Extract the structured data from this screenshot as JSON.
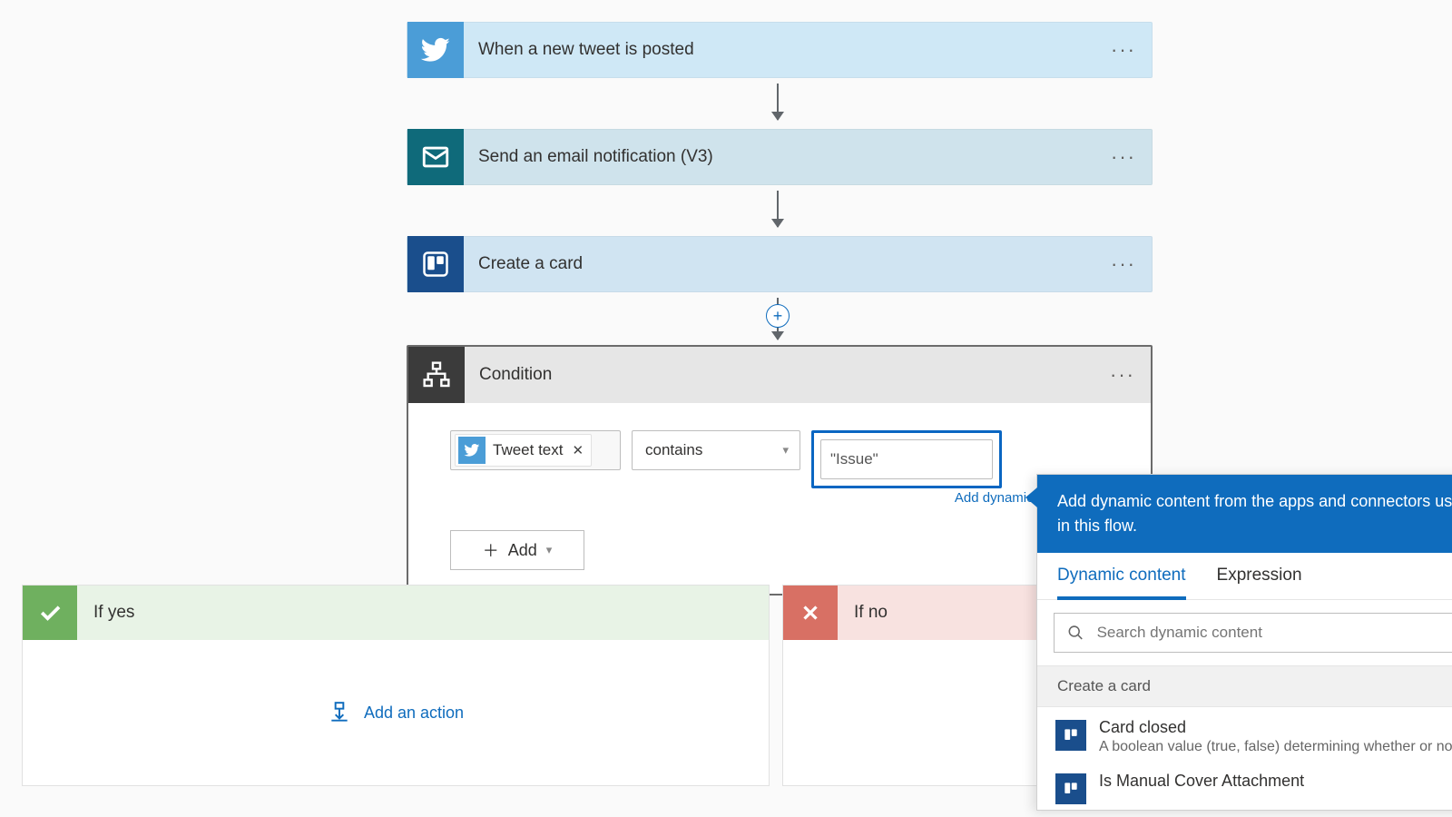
{
  "steps": {
    "twitter": {
      "title": "When a new tweet is posted"
    },
    "email": {
      "title": "Send an email notification (V3)"
    },
    "trello": {
      "title": "Create a card"
    }
  },
  "condition": {
    "title": "Condition",
    "token": {
      "label": "Tweet text"
    },
    "operator": "contains",
    "value": "\"Issue\"",
    "add_dynamic_link": "Add dynamic content",
    "add_button": "Add"
  },
  "branches": {
    "yes": {
      "title": "If yes",
      "action_link": "Add an action"
    },
    "no": {
      "title": "If no"
    }
  },
  "dcp": {
    "banner": "Add dynamic content from the apps and connectors used in this flow.",
    "tabs": {
      "dynamic": "Dynamic content",
      "expression": "Expression"
    },
    "search_placeholder": "Search dynamic content",
    "group": "Create a card",
    "items": [
      {
        "title": "Card closed",
        "sub": "A boolean value (true, false) determining whether or no"
      },
      {
        "title": "Is Manual Cover Attachment",
        "sub": ""
      }
    ]
  }
}
